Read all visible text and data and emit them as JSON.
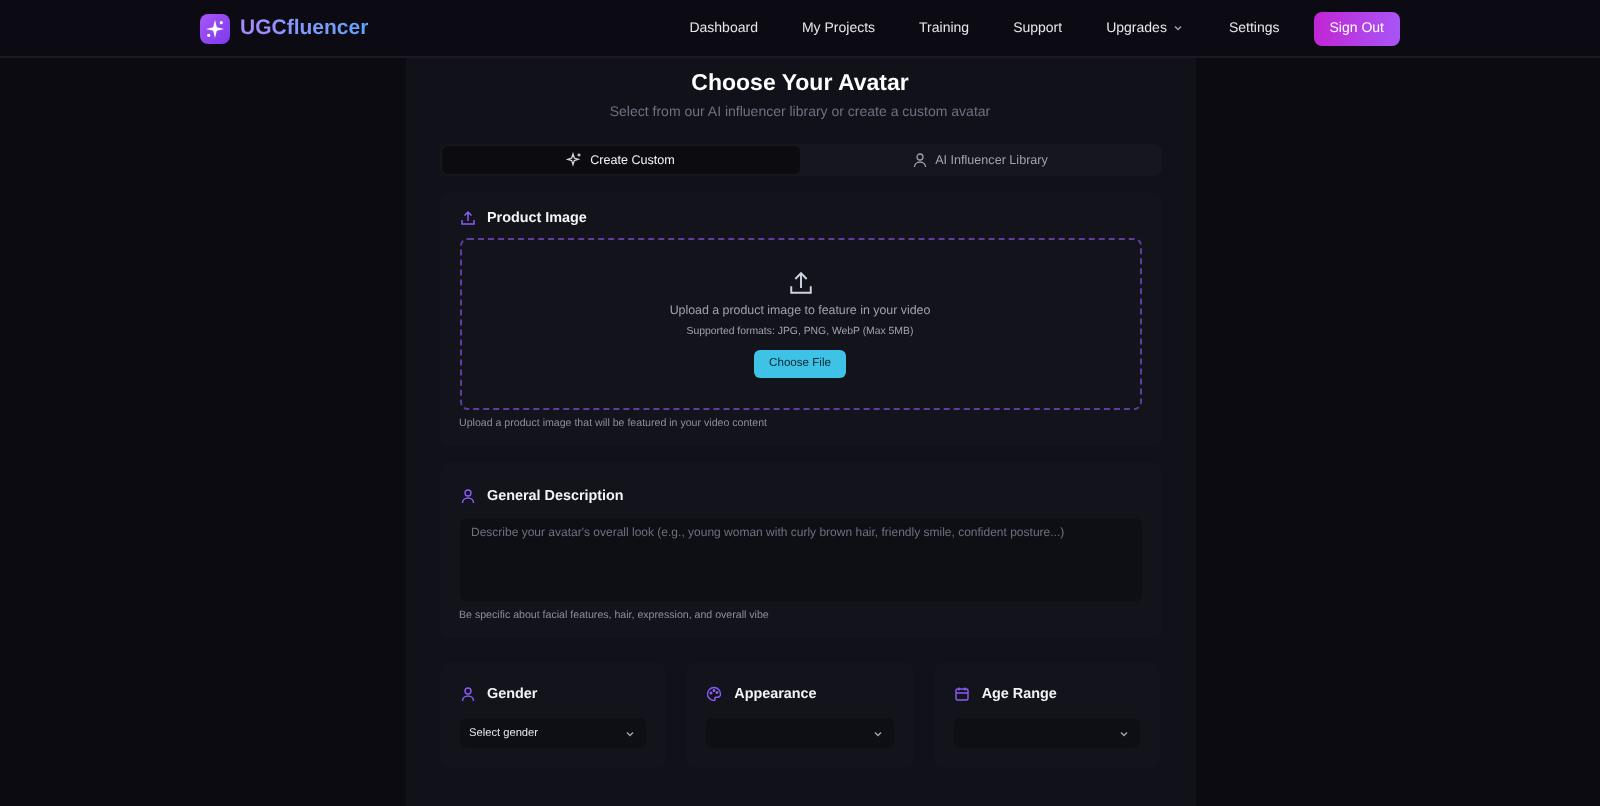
{
  "brand": {
    "name": "UGCfluencer"
  },
  "nav": [
    {
      "label": "Dashboard",
      "kind": "link"
    },
    {
      "label": "My Projects",
      "kind": "link"
    },
    {
      "label": "Training",
      "kind": "link"
    },
    {
      "label": "Support",
      "kind": "link"
    },
    {
      "label": "Upgrades",
      "kind": "menu"
    },
    {
      "label": "Settings",
      "kind": "link"
    }
  ],
  "sign_out": "Sign Out",
  "heading": {
    "title": "Choose Your Avatar",
    "subtitle": "Select from our AI influencer library or create a custom avatar"
  },
  "tabs": [
    {
      "label": "Create Custom",
      "selected": true
    },
    {
      "label": "AI Influencer Library",
      "selected": false
    }
  ],
  "product_image": {
    "title": "Product Image",
    "prompt": "Upload a product image to feature in your video",
    "formats": "Supported formats: JPG, PNG, WebP (Max 5MB)",
    "button": "Choose File",
    "hint": "Upload a product image that will be featured in your video content"
  },
  "description": {
    "title": "General Description",
    "placeholder": "Describe your avatar's overall look (e.g., young woman with curly brown hair, friendly smile, confident posture...)",
    "hint": "Be specific about facial features, hair, expression, and overall vibe"
  },
  "selects": [
    {
      "title": "Gender",
      "kind": "person",
      "value": "Select gender"
    },
    {
      "title": "Appearance",
      "kind": "palette"
    },
    {
      "title": "Age Range",
      "kind": "calendar"
    }
  ]
}
